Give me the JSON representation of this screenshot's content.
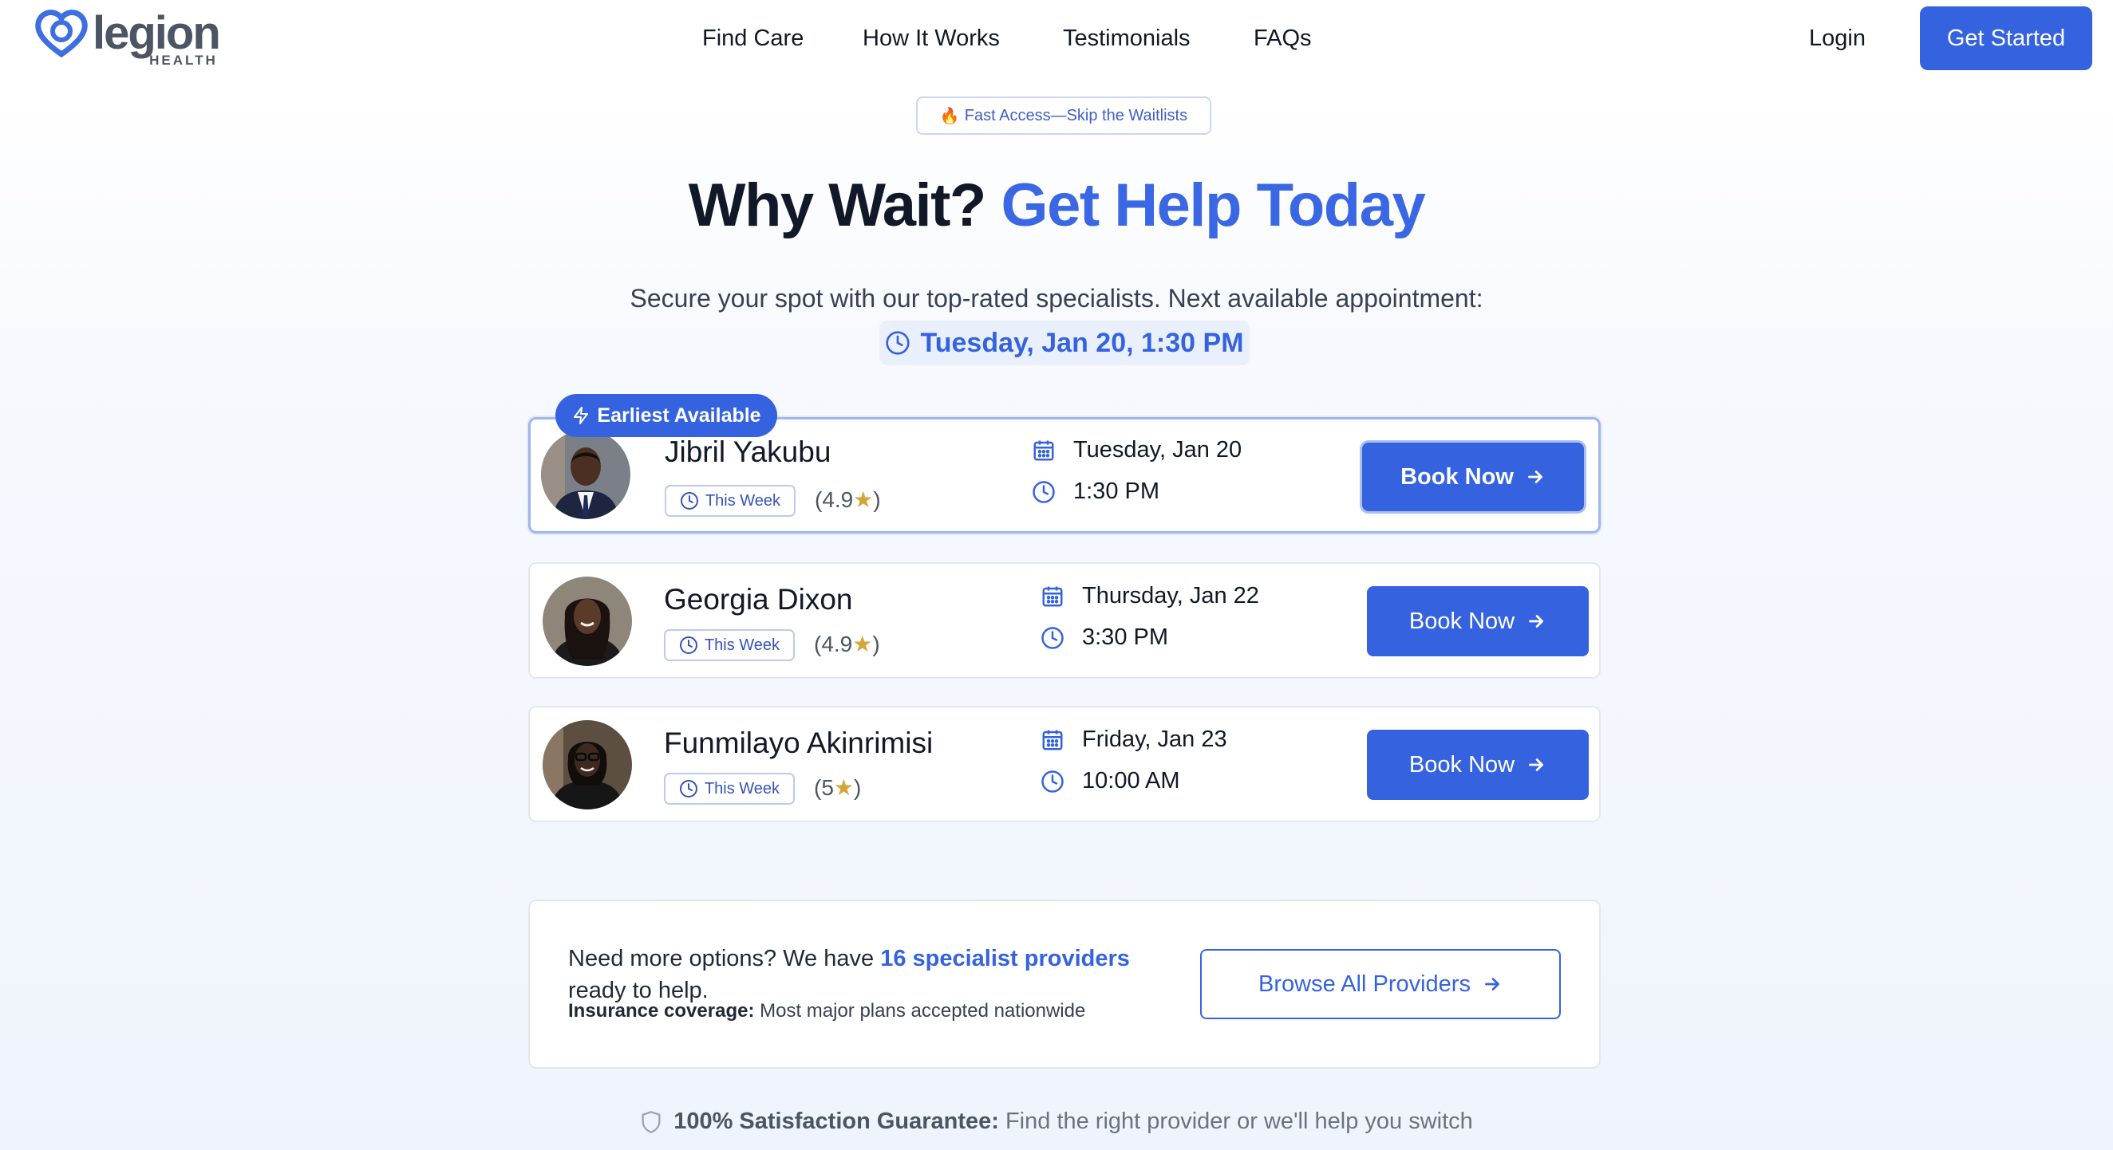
{
  "brand": {
    "name": "legion",
    "sub": "HEALTH",
    "accent": "#3563e0"
  },
  "nav": {
    "items": [
      "Find Care",
      "How It Works",
      "Testimonials",
      "FAQs"
    ],
    "login": "Login",
    "cta": "Get Started"
  },
  "hero": {
    "pill_icon": "fire-icon",
    "pill": "Fast Access—Skip the Waitlists",
    "headline_dark": "Why Wait? ",
    "headline_accent": "Get Help Today",
    "subtitle": "Secure your spot with our top-rated specialists. Next available appointment:",
    "next_appointment": "Tuesday, Jan 20, 1:30 PM"
  },
  "badge": "Earliest Available",
  "providers": [
    {
      "name": "Jibril Yakubu",
      "tag": "This Week",
      "rating_open": "(4.9",
      "rating_close": ")",
      "date": "Tuesday, Jan 20",
      "time": "1:30 PM",
      "cta": "Book Now"
    },
    {
      "name": "Georgia Dixon",
      "tag": "This Week",
      "rating_open": "(4.9",
      "rating_close": ")",
      "date": "Thursday, Jan 22",
      "time": "3:30 PM",
      "cta": "Book Now"
    },
    {
      "name": "Funmilayo Akinrimisi",
      "tag": "This Week",
      "rating_open": "(5",
      "rating_close": ")",
      "date": "Friday, Jan 23",
      "time": "10:00 AM",
      "cta": "Book Now"
    }
  ],
  "more": {
    "text_before": "Need more options? We have ",
    "highlight": "16 specialist providers",
    "text_after": " ready to help.",
    "insurance_label": "Insurance coverage:",
    "insurance_text": " Most major plans accepted nationwide",
    "browse": "Browse All Providers"
  },
  "guarantee": {
    "label": "100% Satisfaction Guarantee:",
    "text": "Find the right provider or we'll help you switch"
  }
}
